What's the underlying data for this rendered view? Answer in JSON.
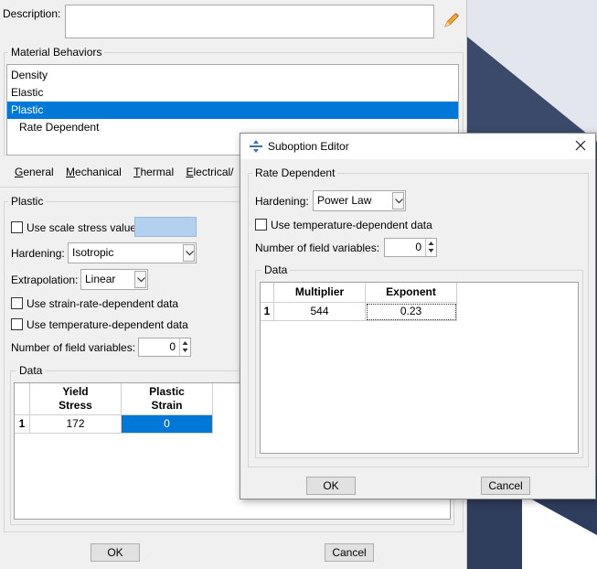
{
  "main": {
    "description_label": "Description:",
    "description_value": "",
    "behaviors_title": "Material Behaviors",
    "behaviors": [
      "Density",
      "Elastic",
      "Plastic",
      "Rate Dependent"
    ],
    "selected_behavior": "Plastic",
    "menu_tabs": [
      {
        "label": "General",
        "ul": "G",
        "rest": "eneral"
      },
      {
        "label": "Mechanical",
        "ul": "M",
        "rest": "echanical"
      },
      {
        "label": "Thermal",
        "ul": "T",
        "rest": "hermal"
      },
      {
        "label": "Electrical/",
        "ul": "E",
        "rest": "lectrical/"
      }
    ],
    "plastic_title": "Plastic",
    "use_scale_stress": "Use scale stress value:",
    "hardening_label": "Hardening:",
    "hardening_value": "Isotropic",
    "extrapolation_label": "Extrapolation:",
    "extrapolation_value": "Linear",
    "strain_rate_label": "Use strain-rate-dependent data",
    "temp_dep_label": "Use temperature-dependent data",
    "field_vars_label": "Number of field variables:",
    "field_vars_value": "0",
    "data_title": "Data",
    "table": {
      "col1_line1": "Yield",
      "col1_line2": "Stress",
      "col2_line1": "Plastic",
      "col2_line2": "Strain",
      "row_num": "1",
      "row_yield": "172",
      "row_strain": "0"
    },
    "ok": "OK",
    "cancel": "Cancel"
  },
  "suboption": {
    "title": "Suboption Editor",
    "group_title": "Rate Dependent",
    "hardening_label": "Hardening:",
    "hardening_value": "Power Law",
    "temp_dep_label": "Use temperature-dependent data",
    "field_vars_label": "Number of field variables:",
    "field_vars_value": "0",
    "data_title": "Data",
    "table": {
      "col1": "Multiplier",
      "col2": "Exponent",
      "row_num": "1",
      "multiplier": "544",
      "exponent": "0.23"
    },
    "ok": "OK",
    "cancel": "Cancel"
  },
  "colors": {
    "selection": "#0078d7",
    "scale_stress_field": "#b3d0ee"
  }
}
